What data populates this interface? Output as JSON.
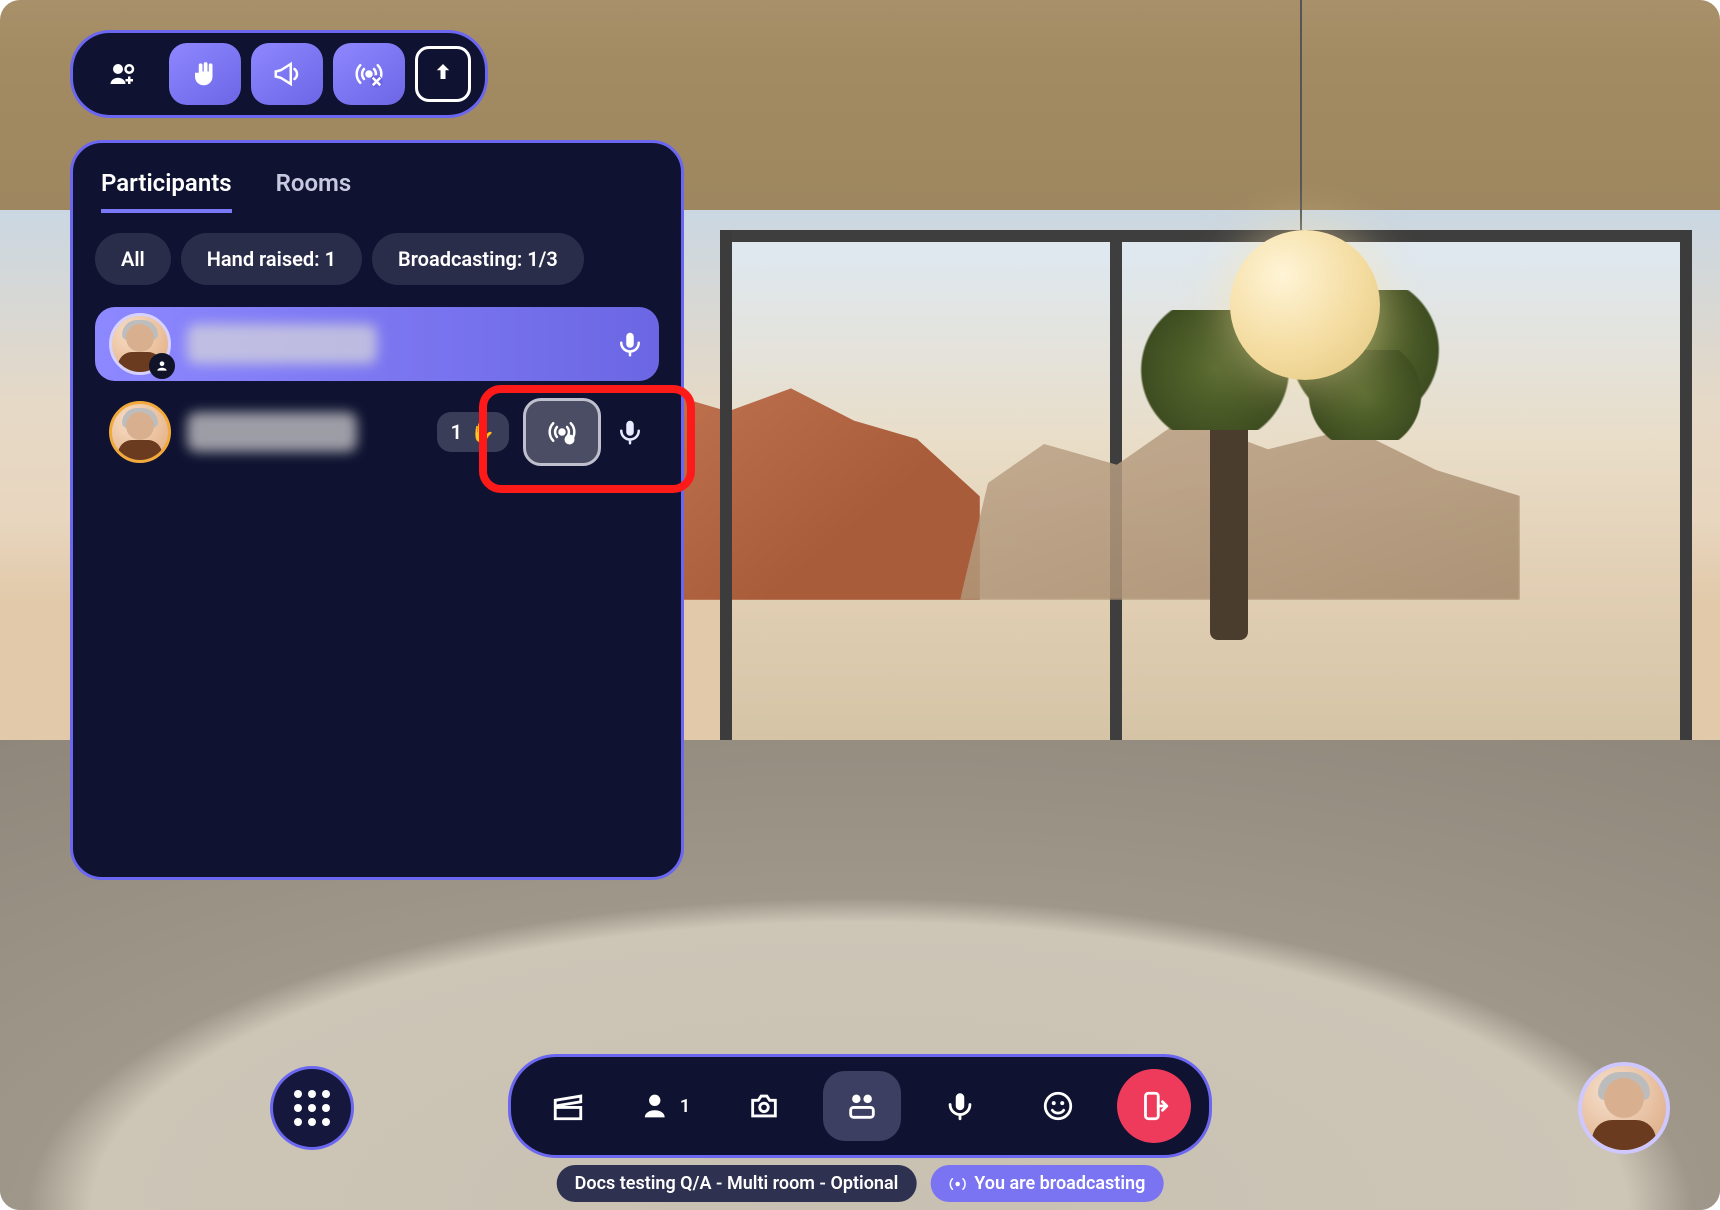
{
  "top_menu": {
    "icons": [
      "people-add-icon",
      "hand-raise-icon",
      "megaphone-icon",
      "broadcast-off-icon",
      "share-up-icon"
    ]
  },
  "panel": {
    "tabs": {
      "participants": "Participants",
      "rooms": "Rooms",
      "active": "participants"
    },
    "filters": {
      "all": "All",
      "hand_raised": "Hand raised: 1",
      "broadcasting": "Broadcasting: 1/3"
    },
    "participants": [
      {
        "selected": true,
        "has_badge": true,
        "mic_on": true
      },
      {
        "selected": false,
        "hand_order": "1",
        "mic_on": true
      }
    ]
  },
  "toolbar": {
    "people_count": "1",
    "icons": [
      "clapper-icon",
      "people-icon",
      "camera-icon",
      "content-icon",
      "mic-icon",
      "emoji-icon",
      "leave-icon"
    ]
  },
  "status": {
    "event_name": "Docs testing Q/A - Multi room - Optional",
    "broadcasting": "You are broadcasting"
  }
}
